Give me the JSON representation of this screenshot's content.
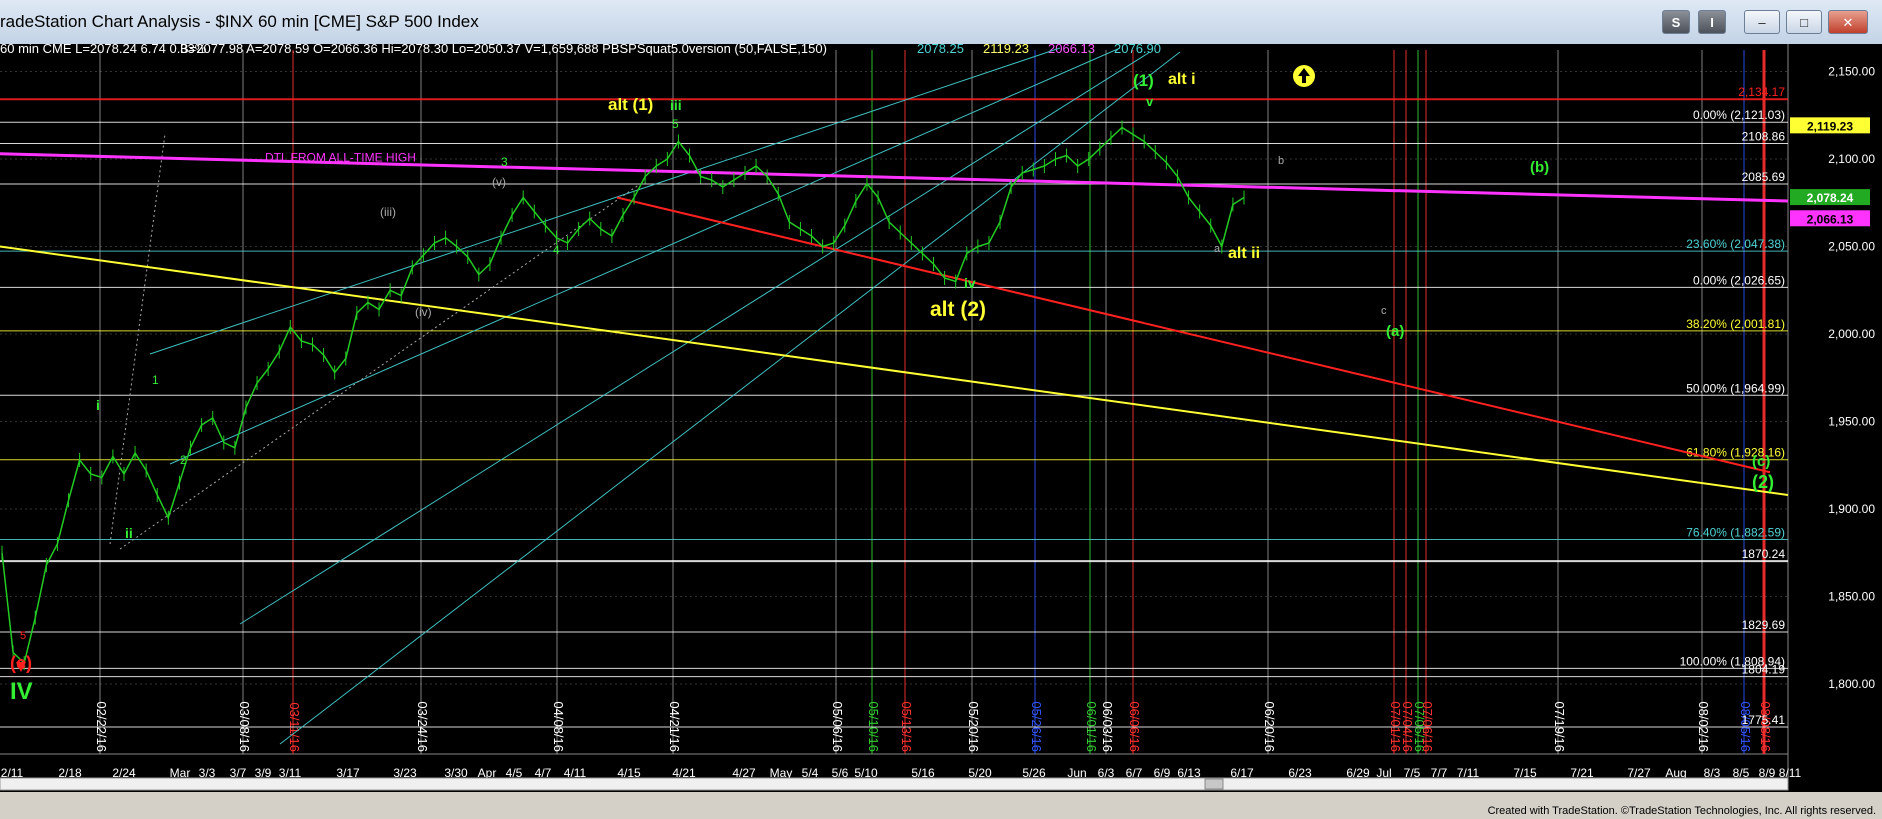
{
  "window": {
    "title": "radeStation Chart Analysis - $INX 60 min [CME] S&P 500 Index",
    "buttons": {
      "s_label": "S",
      "i_label": "I",
      "minimize": "–",
      "maximize": "□",
      "close": "✕"
    },
    "credit": "Created with TradeStation. ©TradeStation Technologies, Inc. All rights reserved."
  },
  "header_readout": [
    {
      "text": "60 min  CME  L=2078.24  6.74   0.33%",
      "color": "#ffffff"
    },
    {
      "text": "B=2077.98  A=2078.59  O=2066.36  Hi=2078.30  Lo=2050.37  V=1,659,688  PBSPSquat5.0version (50,FALSE,150)",
      "color": "#ffffff"
    },
    {
      "text": "2078.25",
      "color": "#4fd3d3"
    },
    {
      "text": "2119.23",
      "color": "#ffff66"
    },
    {
      "text": "2066.13",
      "color": "#ff55ff"
    },
    {
      "text": "2076.90",
      "color": "#4fd3d3"
    }
  ],
  "chart_data": {
    "type": "line",
    "symbol": "$INX 60 min [CME] S&P 500 Index",
    "ylim": [
      1760,
      2160
    ],
    "y_ticks": [
      "2,150.00",
      "2,100.00",
      "2,050.00",
      "2,000.00",
      "1,950.00",
      "1,900.00",
      "1,850.00",
      "1,800.00"
    ],
    "x_ticks": [
      "2/11",
      "2/18",
      "2/24",
      "Mar",
      "3/3",
      "3/7",
      "3/9",
      "3/11",
      "3/17",
      "3/23",
      "3/30",
      "Apr",
      "4/5",
      "4/7",
      "4/11",
      "4/15",
      "4/21",
      "4/27",
      "May",
      "5/4",
      "5/6",
      "5/10",
      "5/16",
      "5/20",
      "5/26",
      "Jun",
      "6/3",
      "6/7",
      "6/9",
      "6/13",
      "6/17",
      "6/23",
      "6/29",
      "Jul",
      "7/5",
      "7/7",
      "7/11",
      "7/15",
      "7/21",
      "7/27",
      "Aug",
      "8/3",
      "8/5",
      "8/9",
      "8/11"
    ],
    "date_markers": [
      {
        "label": "02/22/16",
        "color": "#ffffff"
      },
      {
        "label": "03/08/16",
        "color": "#ffffff"
      },
      {
        "label": "03/11/16",
        "color": "#ff3030"
      },
      {
        "label": "03/24/16",
        "color": "#ffffff"
      },
      {
        "label": "04/08/16",
        "color": "#ffffff"
      },
      {
        "label": "04/21/16",
        "color": "#ffffff"
      },
      {
        "label": "05/06/16",
        "color": "#ffffff"
      },
      {
        "label": "05/10/16",
        "color": "#33cc33"
      },
      {
        "label": "05/13/16",
        "color": "#ff3030"
      },
      {
        "label": "05/20/16",
        "color": "#ffffff"
      },
      {
        "label": "05/26/16",
        "color": "#3355ff"
      },
      {
        "label": "06/01/16",
        "color": "#33cc33"
      },
      {
        "label": "06/03/16",
        "color": "#ffffff"
      },
      {
        "label": "06/06/16",
        "color": "#ff3030"
      },
      {
        "label": "06/20/16",
        "color": "#ffffff"
      },
      {
        "label": "07/01/16",
        "color": "#ff3030"
      },
      {
        "label": "07/04/16",
        "color": "#ff3030"
      },
      {
        "label": "07/05/16",
        "color": "#33cc33"
      },
      {
        "label": "07/06/16",
        "color": "#ff3030"
      },
      {
        "label": "07/19/16",
        "color": "#ffffff"
      },
      {
        "label": "08/02/16",
        "color": "#ffffff"
      },
      {
        "label": "08/05/16",
        "color": "#3355ff"
      },
      {
        "label": "08/08/16",
        "color": "#ff3030"
      }
    ],
    "price_series": [
      [
        0,
        1875
      ],
      [
        1,
        1818
      ],
      [
        2,
        1812
      ],
      [
        3,
        1838
      ],
      [
        4,
        1868
      ],
      [
        5,
        1880
      ],
      [
        6,
        1905
      ],
      [
        7,
        1928
      ],
      [
        8,
        1920
      ],
      [
        9,
        1918
      ],
      [
        10,
        1930
      ],
      [
        11,
        1920
      ],
      [
        12,
        1932
      ],
      [
        13,
        1922
      ],
      [
        14,
        1908
      ],
      [
        15,
        1895
      ],
      [
        16,
        1915
      ],
      [
        17,
        1935
      ],
      [
        18,
        1948
      ],
      [
        19,
        1952
      ],
      [
        20,
        1938
      ],
      [
        21,
        1935
      ],
      [
        22,
        1958
      ],
      [
        23,
        1972
      ],
      [
        24,
        1980
      ],
      [
        25,
        1990
      ],
      [
        26,
        2004
      ],
      [
        27,
        1996
      ],
      [
        28,
        1994
      ],
      [
        29,
        1988
      ],
      [
        30,
        1978
      ],
      [
        31,
        1986
      ],
      [
        32,
        2012
      ],
      [
        33,
        2018
      ],
      [
        34,
        2014
      ],
      [
        35,
        2025
      ],
      [
        36,
        2022
      ],
      [
        37,
        2038
      ],
      [
        38,
        2045
      ],
      [
        39,
        2052
      ],
      [
        40,
        2055
      ],
      [
        41,
        2050
      ],
      [
        42,
        2044
      ],
      [
        43,
        2034
      ],
      [
        44,
        2040
      ],
      [
        45,
        2055
      ],
      [
        46,
        2068
      ],
      [
        47,
        2078
      ],
      [
        48,
        2070
      ],
      [
        49,
        2062
      ],
      [
        50,
        2055
      ],
      [
        51,
        2052
      ],
      [
        52,
        2060
      ],
      [
        53,
        2066
      ],
      [
        54,
        2060
      ],
      [
        55,
        2056
      ],
      [
        56,
        2068
      ],
      [
        57,
        2078
      ],
      [
        58,
        2090
      ],
      [
        59,
        2096
      ],
      [
        60,
        2100
      ],
      [
        61,
        2110
      ],
      [
        62,
        2102
      ],
      [
        63,
        2090
      ],
      [
        64,
        2088
      ],
      [
        65,
        2084
      ],
      [
        66,
        2088
      ],
      [
        67,
        2092
      ],
      [
        68,
        2096
      ],
      [
        69,
        2090
      ],
      [
        70,
        2080
      ],
      [
        71,
        2064
      ],
      [
        72,
        2060
      ],
      [
        73,
        2056
      ],
      [
        74,
        2050
      ],
      [
        75,
        2052
      ],
      [
        76,
        2062
      ],
      [
        77,
        2076
      ],
      [
        78,
        2086
      ],
      [
        79,
        2078
      ],
      [
        80,
        2064
      ],
      [
        81,
        2058
      ],
      [
        82,
        2052
      ],
      [
        83,
        2046
      ],
      [
        84,
        2040
      ],
      [
        85,
        2032
      ],
      [
        86,
        2030
      ],
      [
        87,
        2046
      ],
      [
        88,
        2050
      ],
      [
        89,
        2052
      ],
      [
        90,
        2064
      ],
      [
        91,
        2084
      ],
      [
        92,
        2092
      ],
      [
        93,
        2094
      ],
      [
        94,
        2096
      ],
      [
        95,
        2100
      ],
      [
        96,
        2102
      ],
      [
        97,
        2096
      ],
      [
        98,
        2100
      ],
      [
        99,
        2106
      ],
      [
        100,
        2112
      ],
      [
        101,
        2118
      ],
      [
        102,
        2114
      ],
      [
        103,
        2110
      ],
      [
        104,
        2104
      ],
      [
        105,
        2098
      ],
      [
        106,
        2090
      ],
      [
        107,
        2078
      ],
      [
        108,
        2070
      ],
      [
        109,
        2062
      ],
      [
        110,
        2050
      ],
      [
        111,
        2074
      ],
      [
        112,
        2078
      ]
    ],
    "series_x_start": 2,
    "series_x_end": 1244,
    "horizontal_lines": [
      {
        "value": 2134.17,
        "label": "2,134.17",
        "color": "#ff2020",
        "weight": 2
      },
      {
        "value": 2121.03,
        "label": "0.00% (2,121.03)",
        "color": "#ffffff",
        "weight": 1
      },
      {
        "value": 2108.86,
        "label": "2108.86",
        "color": "#ffffff",
        "weight": 1
      },
      {
        "value": 2085.69,
        "label": "2085.69",
        "color": "#ffffff",
        "weight": 1
      },
      {
        "value": 2047.38,
        "label": "23.60% (2,047.38)",
        "color": "#4fd3d3",
        "weight": 1
      },
      {
        "value": 2026.65,
        "label": "0.00% (2,026.65)",
        "color": "#ffffff",
        "weight": 1
      },
      {
        "value": 2001.81,
        "label": "38.20% (2,001.81)",
        "color": "#ffff33",
        "weight": 1
      },
      {
        "value": 1964.99,
        "label": "50.00% (1,964.99)",
        "color": "#ffffff",
        "weight": 1
      },
      {
        "value": 1928.16,
        "label": "61.80% (1,928.16)",
        "color": "#ffff33",
        "weight": 1
      },
      {
        "value": 1882.59,
        "label": "76.40% (1,882.59)",
        "color": "#4fd3d3",
        "weight": 1
      },
      {
        "value": 1870.24,
        "label": "1870.24",
        "color": "#ffffff",
        "weight": 2
      },
      {
        "value": 1829.69,
        "label": "1829.69",
        "color": "#ffffff",
        "weight": 1
      },
      {
        "value": 1808.94,
        "label": "100.00% (1,808.94)",
        "color": "#ffffff",
        "weight": 1
      },
      {
        "value": 1804.19,
        "label": "1804.19",
        "color": "#ffffff",
        "weight": 1
      },
      {
        "value": 1775.41,
        "label": "1775.41",
        "color": "#ffffff",
        "weight": 1
      }
    ],
    "right_badges": [
      {
        "value": 2119.23,
        "label": "2,119.23",
        "bg": "#ffff33",
        "fg": "#000000"
      },
      {
        "value": 2078.24,
        "label": "2,078.24",
        "bg": "#22aa22",
        "fg": "#ffffff"
      },
      {
        "value": 2066.13,
        "label": "2,066.13",
        "bg": "#ff33ff",
        "fg": "#000000"
      }
    ],
    "trendline_text": "DTL FROM ALL-TIME HIGH",
    "annotations": [
      {
        "text": "alt (1)",
        "color": "#ffff33",
        "size": 17,
        "bold": true
      },
      {
        "text": "iii",
        "color": "#33ee33",
        "size": 14,
        "bold": true
      },
      {
        "text": "(1)",
        "color": "#33ee33",
        "size": 17,
        "bold": true
      },
      {
        "text": "alt i",
        "color": "#ffff33",
        "size": 16,
        "bold": true
      },
      {
        "text": "v",
        "color": "#33ee33",
        "size": 13,
        "bold": true
      },
      {
        "text": "alt ii",
        "color": "#ffff33",
        "size": 16,
        "bold": true
      },
      {
        "text": "alt (2)",
        "color": "#ffff33",
        "size": 21,
        "bold": true
      },
      {
        "text": "iv",
        "color": "#33ee33",
        "size": 14,
        "bold": true
      },
      {
        "text": "(b)",
        "color": "#33ee33",
        "size": 15,
        "bold": true
      },
      {
        "text": "(a)",
        "color": "#33ee33",
        "size": 15,
        "bold": true
      },
      {
        "text": "(c)",
        "color": "#33ee33",
        "size": 15,
        "bold": true
      },
      {
        "text": "(2)",
        "color": "#33ee33",
        "size": 18,
        "bold": true
      },
      {
        "text": "IV",
        "color": "#33ee33",
        "size": 24,
        "bold": true
      },
      {
        "text": "(c)",
        "color": "#ff2020",
        "size": 18,
        "bold": true
      },
      {
        "text": "5",
        "color": "#ff2020",
        "size": 11,
        "bold": false
      },
      {
        "text": "ii",
        "color": "#33ee33",
        "size": 14,
        "bold": true
      },
      {
        "text": "i",
        "color": "#33ee33",
        "size": 14,
        "bold": true
      },
      {
        "text": "1",
        "color": "#33ee33",
        "size": 12,
        "bold": false
      },
      {
        "text": "2",
        "color": "#33ee33",
        "size": 12,
        "bold": false
      },
      {
        "text": "(iii)",
        "color": "#aaaaaa",
        "size": 12,
        "bold": false
      },
      {
        "text": "(iv)",
        "color": "#aaaaaa",
        "size": 12,
        "bold": false
      },
      {
        "text": "(v)",
        "color": "#aaaaaa",
        "size": 12,
        "bold": false
      },
      {
        "text": "3",
        "color": "#33ee33",
        "size": 12,
        "bold": false
      },
      {
        "text": "4",
        "color": "#33ee33",
        "size": 12,
        "bold": false
      },
      {
        "text": "5",
        "color": "#33ee33",
        "size": 12,
        "bold": false
      },
      {
        "text": "a",
        "color": "#aaaaaa",
        "size": 11,
        "bold": false
      },
      {
        "text": "b",
        "color": "#aaaaaa",
        "size": 11,
        "bold": false
      },
      {
        "text": "c",
        "color": "#aaaaaa",
        "size": 11,
        "bold": false
      }
    ]
  }
}
